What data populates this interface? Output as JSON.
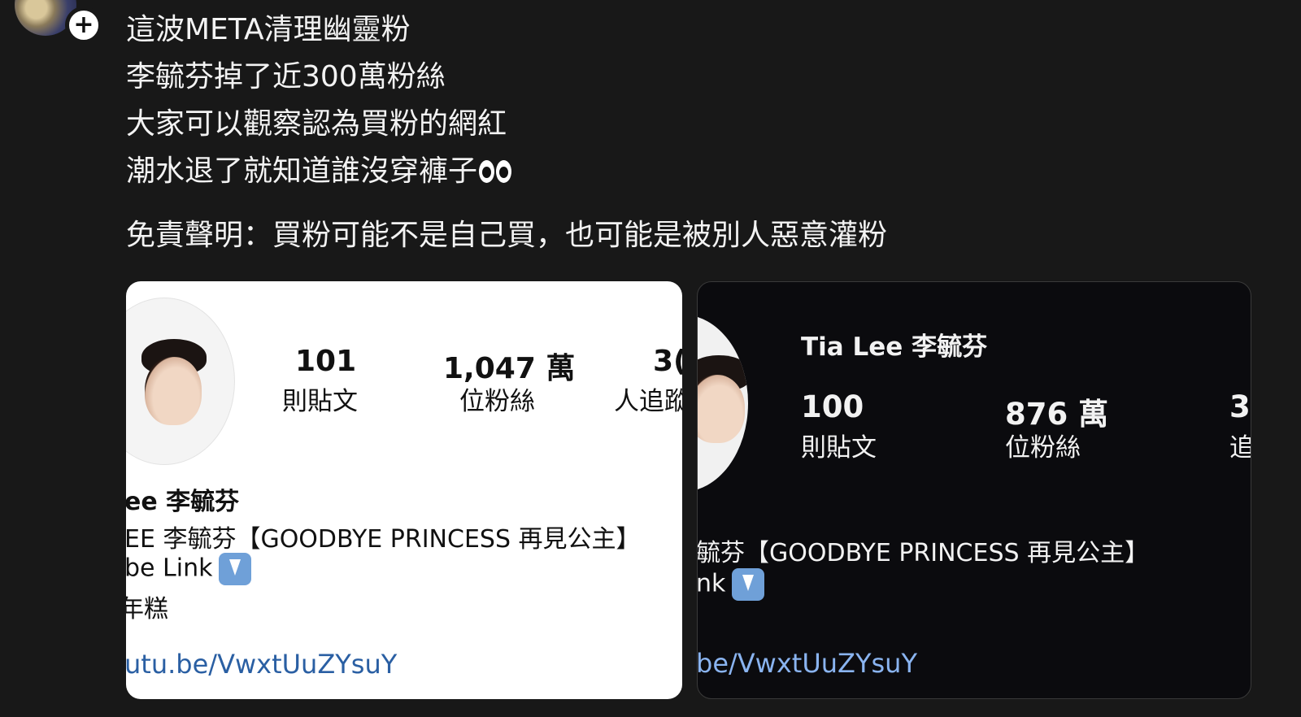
{
  "post": {
    "lines": [
      "這波META清理幽靈粉",
      "李毓芬掉了近300萬粉絲",
      "大家可以觀察認為買粉的網紅",
      "潮水退了就知道誰沒穿褲子"
    ],
    "emoji_eyes": "eyes-emoji",
    "disclaimer": "免責聲明：買粉可能不是自己買，也可能是被別人惡意灌粉",
    "follow_icon": "plus-icon",
    "follow_symbol": "+"
  },
  "before": {
    "posts_count": "101",
    "posts_label": "則貼文",
    "followers_count": "1,047 萬",
    "followers_label": "位粉絲",
    "following_count": "3(",
    "following_label": "人追蹤",
    "name": "ee 李毓芬",
    "bio1": "EE 李毓芬【GOODBYE PRINCESS 再見公主】",
    "bio2": "be Link",
    "bio3": "年糕",
    "link": "utu.be/VwxtUuZYsuY"
  },
  "after": {
    "name": "Tia Lee 李毓芬",
    "posts_count": "100",
    "posts_label": "則貼文",
    "followers_count": "876 萬",
    "followers_label": "位粉絲",
    "following_count": "3",
    "following_label": "追",
    "bio1": "毓芬【GOODBYE PRINCESS 再見公主】",
    "bio2": "nk",
    "link": "be/VwxtUuZYsuY"
  },
  "colors": {
    "background": "#181818",
    "link": "#2a5fa3",
    "emoji_tile": "#6fa0d8"
  }
}
